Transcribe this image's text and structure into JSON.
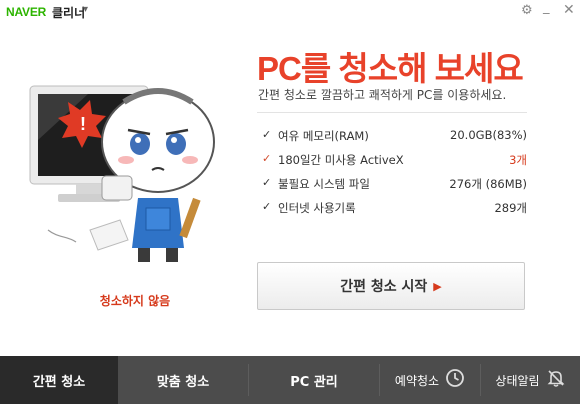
{
  "titlebar": {
    "brand": "NAVER",
    "app_name": "클리너",
    "menu_icon": "chevron-down-icon",
    "settings_icon": "gear-icon",
    "minimize_icon": "minimize-icon",
    "close_icon": "close-icon"
  },
  "illustration": {
    "status_text": "청소하지 않음"
  },
  "main": {
    "headline": "PC를 청소해 보세요",
    "subline": "간편 청소로 깔끔하고 쾌적하게 PC를 이용하세요.",
    "stats": [
      {
        "label": "여유 메모리(RAM)",
        "value": "20.0GB(83%)",
        "highlight": false
      },
      {
        "label": "180일간 미사용 ActiveX",
        "value": "3개",
        "highlight": true
      },
      {
        "label": "불필요 시스템 파일",
        "value": "276개 (86MB)",
        "highlight": false
      },
      {
        "label": "인터넷 사용기록",
        "value": "289개",
        "highlight": false
      }
    ],
    "start_button": "간편 청소 시작"
  },
  "tabs": {
    "easy": "간편 청소",
    "custom": "맞춤 청소",
    "pc_manage": "PC 관리",
    "schedule": "예약청소",
    "notification": "상태알림"
  },
  "colors": {
    "accent": "#e8422a",
    "brand_green": "#2db400",
    "tab_bar": "#4c4c4c",
    "tab_active": "#2a2a2a"
  }
}
